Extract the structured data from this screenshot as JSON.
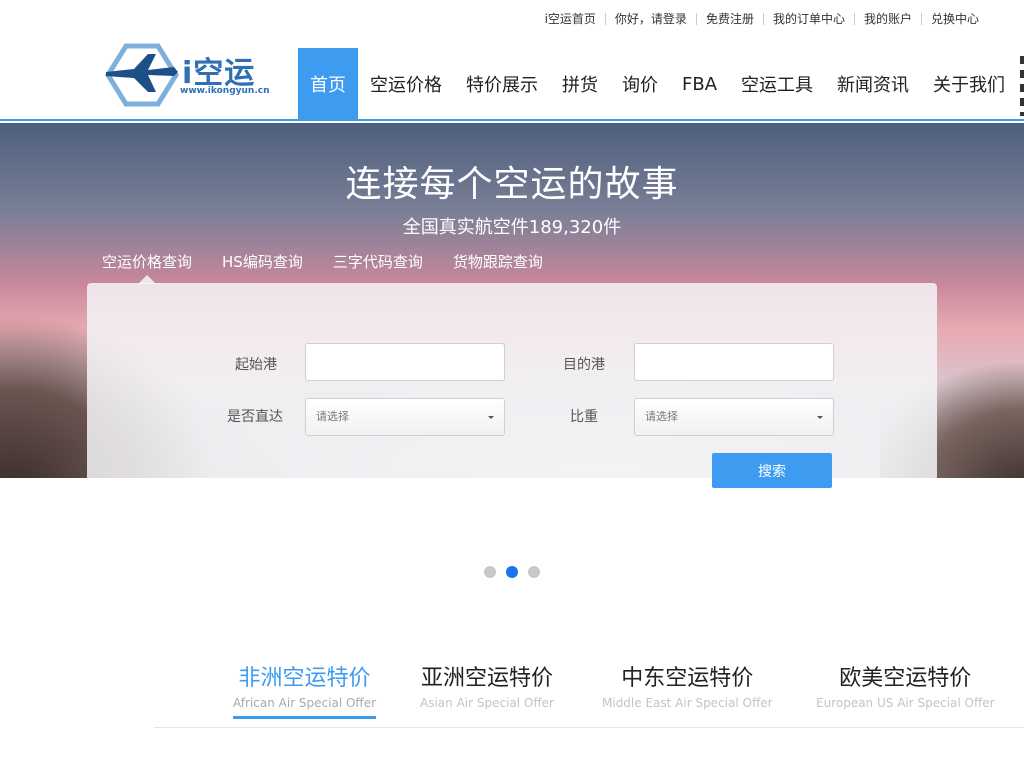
{
  "topbar": {
    "links": [
      "i空运首页",
      "你好，请登录",
      "免费注册",
      "我的订单中心",
      "我的账户",
      "兑换中心"
    ]
  },
  "logo": {
    "name": "i空运",
    "url": "www.ikongyun.cn"
  },
  "nav": {
    "items": [
      "首页",
      "空运价格",
      "特价展示",
      "拼货",
      "询价",
      "FBA",
      "空运工具",
      "新闻资讯",
      "关于我们"
    ],
    "active_index": 0
  },
  "hero": {
    "title": "连接每个空运的故事",
    "subtitle": "全国真实航空件189,320件"
  },
  "query_tabs": {
    "items": [
      "空运价格查询",
      "HS编码查询",
      "三字代码查询",
      "货物跟踪查询"
    ],
    "active_index": 0
  },
  "form": {
    "origin_label": "起始港",
    "origin_value": "",
    "dest_label": "目的港",
    "dest_value": "",
    "direct_label": "是否直达",
    "direct_placeholder": "请选择",
    "ratio_label": "比重",
    "ratio_placeholder": "请选择",
    "search_label": "搜索"
  },
  "carousel": {
    "count": 3,
    "active_index": 1
  },
  "offers": [
    {
      "cn": "非洲空运特价",
      "en": "African Air Special Offer",
      "active": true
    },
    {
      "cn": "亚洲空运特价",
      "en": "Asian Air Special Offer",
      "active": false
    },
    {
      "cn": "中东空运特价",
      "en": "Middle East Air Special Offer",
      "active": false
    },
    {
      "cn": "欧美空运特价",
      "en": "European US Air Special Offer",
      "active": false
    }
  ],
  "colors": {
    "accent": "#3d9cf0",
    "active_dot": "#1a73e8",
    "logo": "#2f6fb3"
  }
}
